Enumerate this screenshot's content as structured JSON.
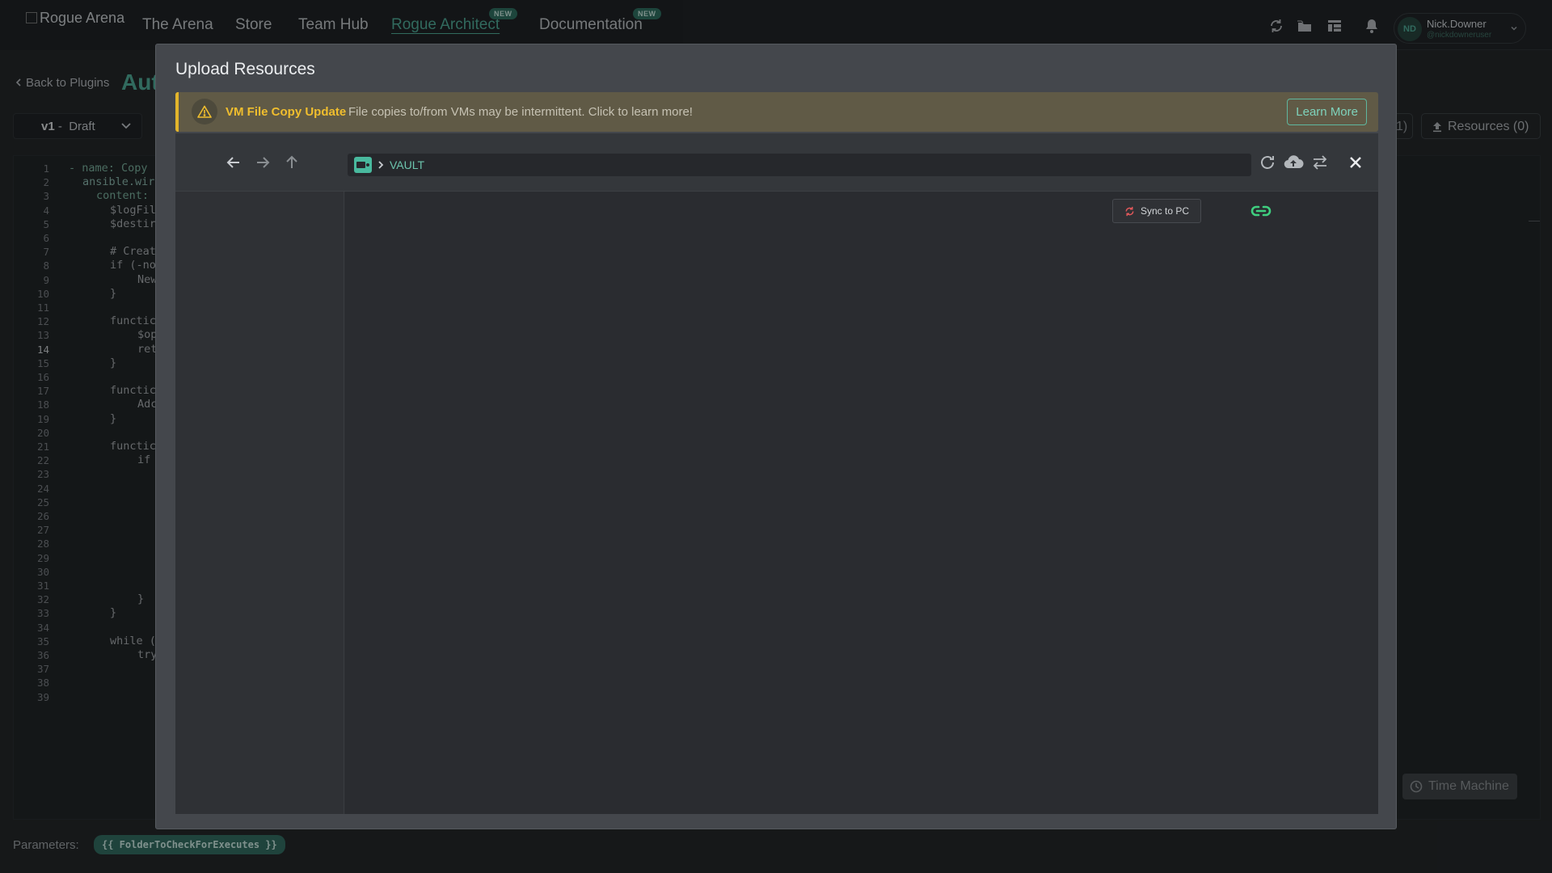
{
  "app": {
    "logo_alt": "Rogue Arena",
    "nav": [
      {
        "label": "The Arena",
        "active": false,
        "new": false
      },
      {
        "label": "Store",
        "active": false,
        "new": false
      },
      {
        "label": "Team Hub",
        "active": false,
        "new": false
      },
      {
        "label": "Rogue Architect",
        "active": true,
        "new": true
      },
      {
        "label": "Documentation",
        "active": false,
        "new": true
      }
    ],
    "new_badge": "NEW",
    "toolbar_icons": [
      "sync-icon",
      "folder-icon",
      "layout-icon",
      "bell-icon"
    ],
    "user": {
      "initials": "ND",
      "name": "Nick.Downer",
      "handle": "@nickdowneruser"
    }
  },
  "page": {
    "back_label": "Back to Plugins",
    "title_partial": "Aut",
    "version": {
      "number": "v1",
      "separator": "-",
      "status": "Draft"
    },
    "resources_label": "Resources (0)",
    "other_count_partial": "1)",
    "time_machine_label": "Time Machine",
    "parameters_label": "Parameters:",
    "parameter_chip": "{{ FolderToCheckForExecutes }}",
    "line_numbers": [
      "1",
      "2",
      "3",
      "4",
      "5",
      "6",
      "7",
      "8",
      "9",
      "10",
      "11",
      "12",
      "13",
      "14",
      "15",
      "16",
      "17",
      "18",
      "19",
      "20",
      "21",
      "22",
      "23",
      "24",
      "25",
      "26",
      "27",
      "28",
      "29",
      "30",
      "31",
      "32",
      "33",
      "34",
      "35",
      "36",
      "37",
      "38",
      "39"
    ],
    "current_line": "14",
    "code_lines": [
      {
        "line": 1,
        "indent": 0,
        "text": "- name: Copy",
        "cls": "kw"
      },
      {
        "line": 2,
        "indent": 1,
        "text": "ansible.wir",
        "cls": ""
      },
      {
        "line": 3,
        "indent": 2,
        "text": "content: ",
        "cls": "kw"
      },
      {
        "line": 4,
        "indent": 3,
        "text": "$logFil",
        "cls": "pl"
      },
      {
        "line": 5,
        "indent": 3,
        "text": "$destir",
        "cls": "pl"
      },
      {
        "line": 7,
        "indent": 3,
        "text": "# Creat",
        "cls": "pl"
      },
      {
        "line": 8,
        "indent": 3,
        "text": "if (-no",
        "cls": "pl"
      },
      {
        "line": 9,
        "indent": 5,
        "text": "New",
        "cls": "pl"
      },
      {
        "line": 10,
        "indent": 3,
        "text": "}",
        "cls": "pl"
      },
      {
        "line": 12,
        "indent": 3,
        "text": "functic",
        "cls": "pl"
      },
      {
        "line": 13,
        "indent": 5,
        "text": "$op",
        "cls": "pl"
      },
      {
        "line": 14,
        "indent": 5,
        "text": "ret",
        "cls": "pl"
      },
      {
        "line": 15,
        "indent": 3,
        "text": "}",
        "cls": "pl"
      },
      {
        "line": 17,
        "indent": 3,
        "text": "functic",
        "cls": "pl"
      },
      {
        "line": 18,
        "indent": 5,
        "text": "Adc",
        "cls": "pl"
      },
      {
        "line": 19,
        "indent": 3,
        "text": "}",
        "cls": "pl"
      },
      {
        "line": 21,
        "indent": 3,
        "text": "functic",
        "cls": "pl"
      },
      {
        "line": 22,
        "indent": 5,
        "text": "if",
        "cls": "pl"
      },
      {
        "line": 32,
        "indent": 5,
        "text": "}",
        "cls": "pl"
      },
      {
        "line": 33,
        "indent": 3,
        "text": "}",
        "cls": "pl"
      },
      {
        "line": 35,
        "indent": 3,
        "text": "while (",
        "cls": "pl"
      },
      {
        "line": 36,
        "indent": 5,
        "text": "try",
        "cls": "pl"
      }
    ]
  },
  "modal": {
    "title": "Upload Resources",
    "banner": {
      "title": "VM File Copy Update",
      "text": "File copies to/from VMs may be intermittent. Click to learn more!",
      "button": "Learn More",
      "accent": "#e3b52b"
    },
    "browser": {
      "path": "VAULT",
      "sync_button": "Sync to PC",
      "accent": "#49b99e"
    }
  }
}
